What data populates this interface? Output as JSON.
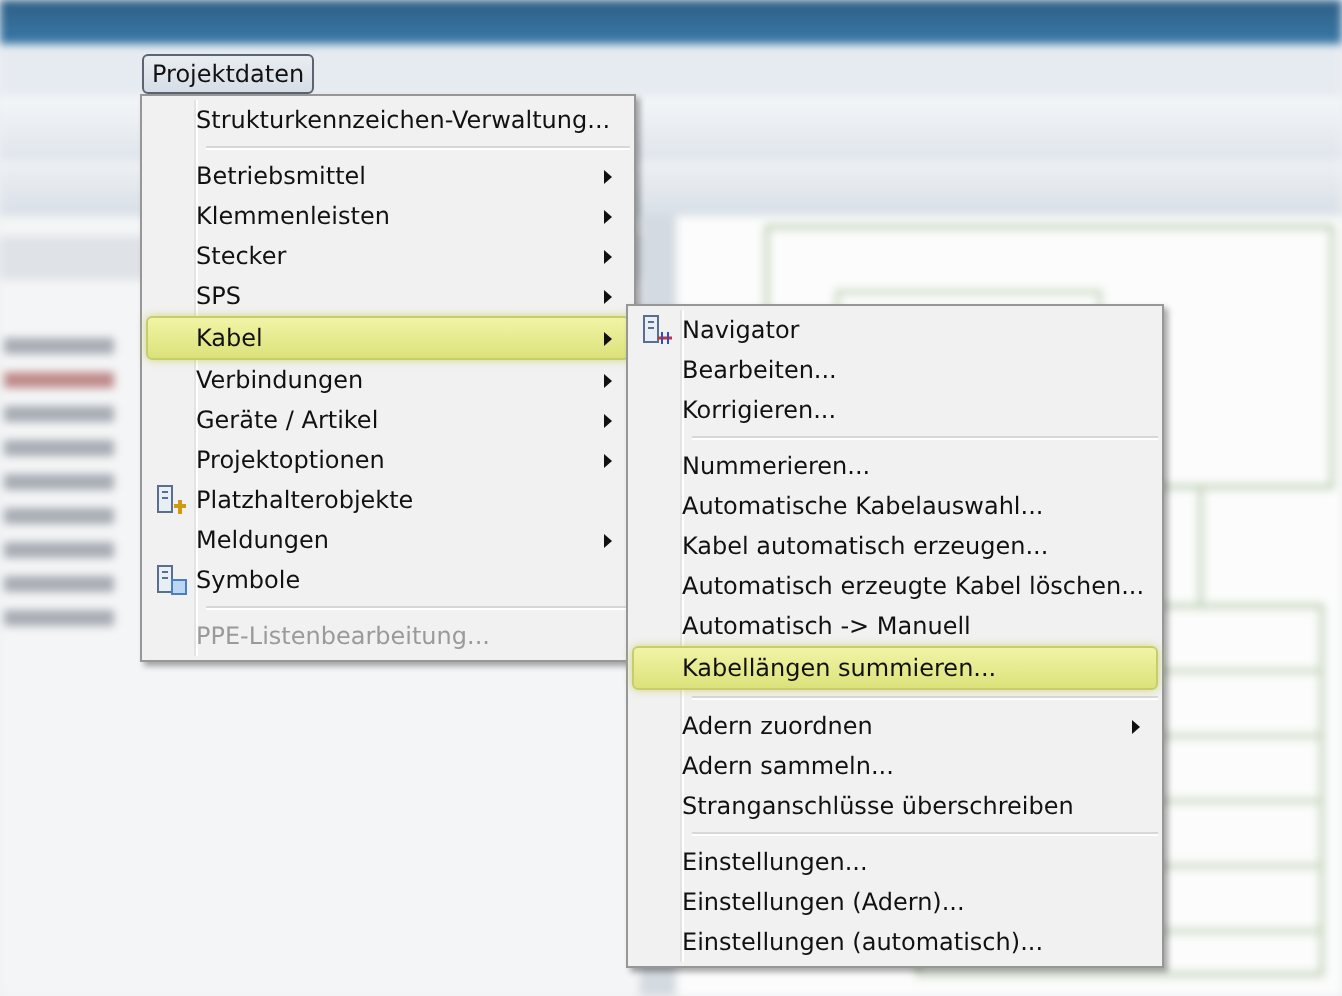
{
  "menu_bar": {
    "open_menu": {
      "label": "Projektdaten",
      "selected": true
    }
  },
  "menu": {
    "items": [
      {
        "kind": "item",
        "label": "Strukturkennzeichen-Verwaltung...",
        "submenu": false,
        "disabled": false,
        "selected": false
      },
      {
        "kind": "separator"
      },
      {
        "kind": "item",
        "label": "Betriebsmittel",
        "submenu": true,
        "disabled": false,
        "selected": false
      },
      {
        "kind": "item",
        "label": "Klemmenleisten",
        "submenu": true,
        "disabled": false,
        "selected": false
      },
      {
        "kind": "item",
        "label": "Stecker",
        "submenu": true,
        "disabled": false,
        "selected": false
      },
      {
        "kind": "item",
        "label": "SPS",
        "submenu": true,
        "disabled": false,
        "selected": false
      },
      {
        "kind": "item",
        "label": "Kabel",
        "submenu": true,
        "disabled": false,
        "selected": true
      },
      {
        "kind": "item",
        "label": "Verbindungen",
        "submenu": true,
        "disabled": false,
        "selected": false
      },
      {
        "kind": "item",
        "label": "Geräte / Artikel",
        "submenu": true,
        "disabled": false,
        "selected": false
      },
      {
        "kind": "item",
        "label": "Projektoptionen",
        "submenu": true,
        "disabled": false,
        "selected": false
      },
      {
        "kind": "icon_item",
        "label": "Platzhalterobjekte",
        "submenu": false,
        "disabled": false,
        "selected": false
      },
      {
        "kind": "item",
        "label": "Meldungen",
        "submenu": true,
        "disabled": false,
        "selected": false
      },
      {
        "kind": "icon_item",
        "label": "Symbole",
        "submenu": false,
        "disabled": false,
        "selected": false
      },
      {
        "kind": "separator"
      },
      {
        "kind": "item",
        "label": "PPE-Listenbearbeitung...",
        "submenu": false,
        "disabled": true,
        "selected": false
      }
    ]
  },
  "submenu": {
    "items": [
      {
        "kind": "icon_item",
        "label": "Navigator",
        "submenu": false,
        "disabled": false,
        "selected": false
      },
      {
        "kind": "item",
        "label": "Bearbeiten...",
        "submenu": false,
        "disabled": false,
        "selected": false
      },
      {
        "kind": "item",
        "label": "Korrigieren...",
        "submenu": false,
        "disabled": false,
        "selected": false
      },
      {
        "kind": "separator"
      },
      {
        "kind": "item",
        "label": "Nummerieren...",
        "submenu": false,
        "disabled": false,
        "selected": false
      },
      {
        "kind": "item",
        "label": "Automatische Kabelauswahl...",
        "submenu": false,
        "disabled": false,
        "selected": false
      },
      {
        "kind": "item",
        "label": "Kabel automatisch erzeugen...",
        "submenu": false,
        "disabled": false,
        "selected": false
      },
      {
        "kind": "item",
        "label": "Automatisch erzeugte Kabel löschen...",
        "submenu": false,
        "disabled": false,
        "selected": false
      },
      {
        "kind": "item",
        "label": "Automatisch -> Manuell",
        "submenu": false,
        "disabled": false,
        "selected": false
      },
      {
        "kind": "item",
        "label": "Kabellängen summieren...",
        "submenu": false,
        "disabled": false,
        "selected": true
      },
      {
        "kind": "separator"
      },
      {
        "kind": "item",
        "label": "Adern zuordnen",
        "submenu": true,
        "disabled": false,
        "selected": false
      },
      {
        "kind": "item",
        "label": "Adern sammeln...",
        "submenu": false,
        "disabled": false,
        "selected": false
      },
      {
        "kind": "item",
        "label": "Stranganschlüsse überschreiben",
        "submenu": false,
        "disabled": false,
        "selected": false
      },
      {
        "kind": "separator"
      },
      {
        "kind": "item",
        "label": "Einstellungen...",
        "submenu": false,
        "disabled": false,
        "selected": false
      },
      {
        "kind": "item",
        "label": "Einstellungen (Adern)...",
        "submenu": false,
        "disabled": false,
        "selected": false
      },
      {
        "kind": "item",
        "label": "Einstellungen (automatisch)...",
        "submenu": false,
        "disabled": false,
        "selected": false
      }
    ]
  }
}
